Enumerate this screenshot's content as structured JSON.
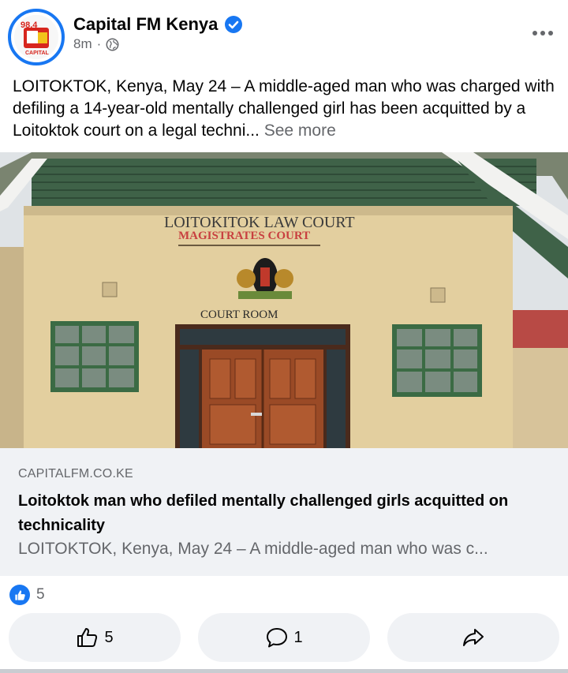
{
  "header": {
    "page_name": "Capital FM Kenya",
    "time_ago": "8m",
    "separator": "·",
    "avatar_text": "98.4",
    "avatar_subtext": "CAPITAL"
  },
  "post": {
    "text": "LOITOKTOK, Kenya, May 24 – A middle-aged man who was charged with defiling a 14-year-old mentally challenged girl has been acquitted by a Loitoktok court on a legal techni...",
    "see_more": "See more"
  },
  "photo": {
    "sign_line1": "LOITOKITOK LAW COURT",
    "sign_line2": "MAGISTRATES COURT",
    "sign_room": "COURT ROOM"
  },
  "link_card": {
    "domain": "CAPITALFM.CO.KE",
    "title": "Loitoktok man who defiled mentally challenged girls acquitted on technicality",
    "description": "LOITOKTOK, Kenya, May 24 – A middle-aged man who was c..."
  },
  "reactions": {
    "count": "5"
  },
  "actions": {
    "like_count": "5",
    "comment_count": "1"
  },
  "colors": {
    "accent": "#1877f2",
    "secondary_text": "#65676b",
    "card_bg": "#f0f2f5"
  },
  "icons": [
    "verified-icon",
    "globe-icon",
    "more-icon",
    "like-icon",
    "comment-icon",
    "share-icon"
  ]
}
